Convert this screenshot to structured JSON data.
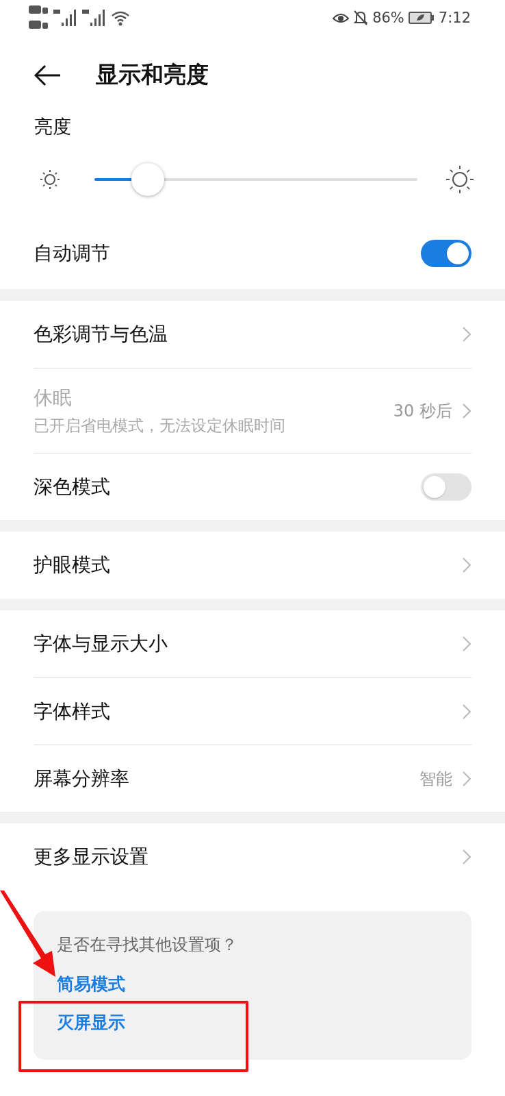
{
  "status_bar": {
    "battery": "86%",
    "time": "7:12"
  },
  "header": {
    "title": "显示和亮度"
  },
  "brightness": {
    "label": "亮度",
    "level": 0.165
  },
  "auto_adjust": {
    "label": "自动调节",
    "on": true
  },
  "groups": [
    {
      "items": [
        {
          "kind": "nav",
          "title": "色彩调节与色温",
          "disabled": false
        },
        {
          "kind": "nav",
          "title": "休眠",
          "subtitle": "已开启省电模式，无法设定休眠时间",
          "value": "30 秒后",
          "disabled": true
        },
        {
          "kind": "toggle",
          "title": "深色模式",
          "on": false,
          "disabled": false
        }
      ]
    },
    {
      "items": [
        {
          "kind": "nav",
          "title": "护眼模式",
          "disabled": false
        }
      ]
    },
    {
      "items": [
        {
          "kind": "nav",
          "title": "字体与显示大小",
          "disabled": false
        },
        {
          "kind": "nav",
          "title": "字体样式",
          "disabled": false
        },
        {
          "kind": "nav",
          "title": "屏幕分辨率",
          "value": "智能",
          "disabled": false
        }
      ]
    },
    {
      "items": [
        {
          "kind": "nav",
          "title": "更多显示设置",
          "disabled": false
        }
      ]
    }
  ],
  "suggestions": {
    "prompt": "是否在寻找其他设置项？",
    "links": [
      "简易模式",
      "灭屏显示"
    ]
  }
}
